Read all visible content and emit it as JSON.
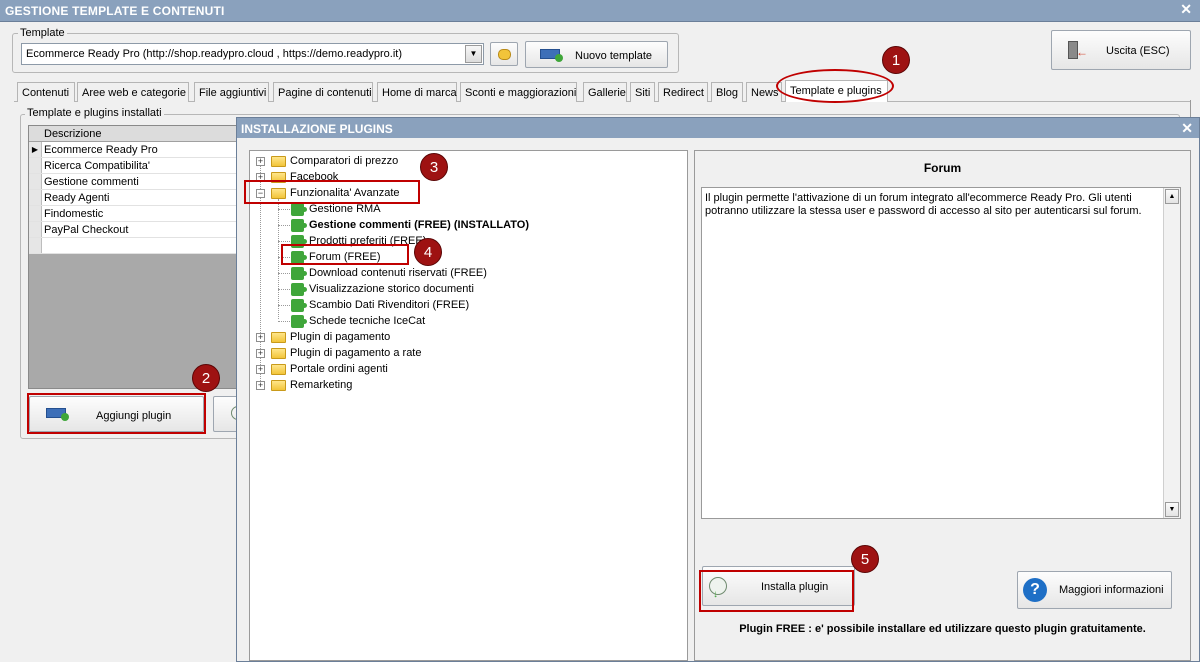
{
  "window": {
    "title": "GESTIONE TEMPLATE E CONTENUTI",
    "close_glyph": "✕"
  },
  "template_group": {
    "label": "Template",
    "selected": "Ecommerce Ready Pro (http://shop.readypro.cloud , https://demo.readypro.it)",
    "new_button": "Nuovo template"
  },
  "exit_button": "Uscita (ESC)",
  "tabs": [
    "Contenuti",
    "Aree web e categorie",
    "File aggiuntivi",
    "Pagine di contenuti",
    "Home di marca",
    "Sconti e maggiorazioni",
    "Gallerie",
    "Siti",
    "Redirect",
    "Blog",
    "News",
    "Template e plugins"
  ],
  "installed": {
    "label": "Template e plugins installati",
    "column": "Descrizione",
    "rows": [
      "Ecommerce Ready Pro",
      "Ricerca Compatibilita'",
      "Gestione commenti",
      "Ready Agenti",
      "Findomestic",
      "PayPal Checkout",
      ""
    ],
    "add_button": "Aggiungi plugin"
  },
  "dialog": {
    "title": "INSTALLAZIONE PLUGINS",
    "close_glyph": "✕",
    "tree": {
      "top": [
        "Comparatori di prezzo",
        "Facebook",
        "Funzionalita' Avanzate"
      ],
      "children": [
        "Gestione RMA",
        "Gestione commenti (FREE) (INSTALLATO)",
        "Prodotti preferiti (FREE)",
        "Forum (FREE)",
        "Download contenuti riservati (FREE)",
        "Visualizzazione storico documenti",
        "Scambio Dati Rivenditori (FREE)",
        "Schede tecniche IceCat"
      ],
      "bottom": [
        "Plugin di pagamento",
        "Plugin di pagamento a rate",
        "Portale ordini agenti",
        "Remarketing"
      ]
    },
    "detail": {
      "title": "Forum",
      "description": "Il plugin permette l'attivazione di un forum integrato all'ecommerce Ready Pro. Gli utenti potranno utilizzare la stessa user e password di accesso al sito per autenticarsi sul forum.",
      "install_button": "Installa plugin",
      "info_button": "Maggiori informazioni",
      "footer": "Plugin FREE : e' possibile installare ed utilizzare questo plugin gratuitamente."
    }
  },
  "callouts": [
    "1",
    "2",
    "3",
    "4",
    "5"
  ],
  "colors": {
    "titlebar": "#8aa1bd",
    "highlight": "#c00000",
    "callout": "#9e1212",
    "plugin_icon": "#3fa63a"
  },
  "icons": {
    "exit": "exit-door-icon",
    "folder": "folder-icon",
    "plugin": "puzzle-icon",
    "install": "globe-download-icon",
    "info": "question-icon",
    "new": "add-template-icon"
  }
}
